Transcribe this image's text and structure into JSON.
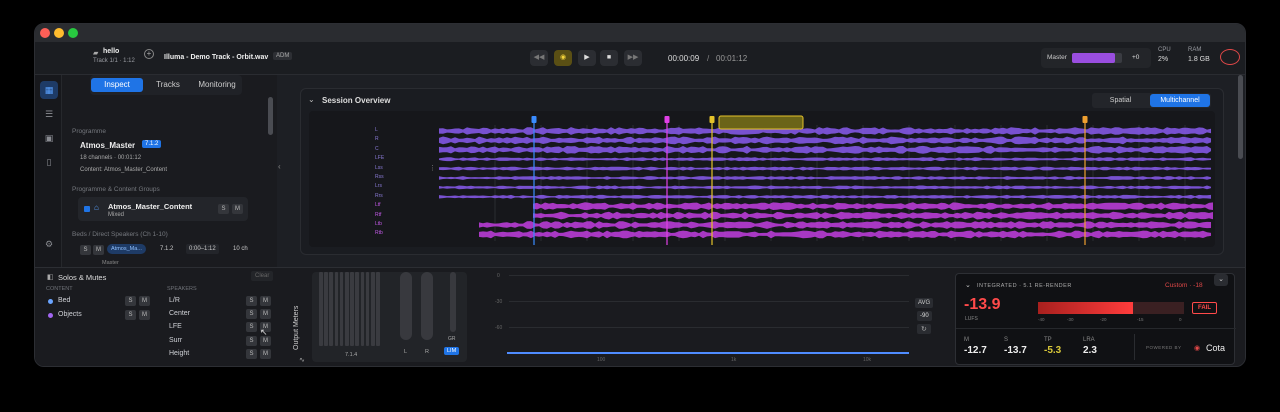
{
  "toolbar": {
    "project_name": "hello",
    "track_info": "Track 1/1 · 1:12",
    "file_title": "Illuma - Demo Track - Orbit.wav",
    "format_badge": "ADM",
    "time_current": "00:00:09",
    "time_sep": "/",
    "time_total": "00:01:12",
    "master_label": "Master",
    "master_gain": "+0",
    "master_level": 0.85,
    "cpu_label": "CPU",
    "cpu_value": "2%",
    "ram_label": "RAM",
    "ram_value": "1.8 GB"
  },
  "inspector": {
    "tabs": [
      "Inspect",
      "Tracks",
      "Monitoring"
    ],
    "active_tab": "Inspect",
    "programme_heading": "Programme",
    "programme_name": "Atmos_Master",
    "programme_badge": "7.1.2",
    "programme_channels": "18 channels · 00:01:12",
    "programme_content": "Content: Atmos_Master_Content",
    "groups_heading": "Programme & Content Groups",
    "group_name": "Atmos_Master_Content",
    "group_kind": "Mixed",
    "beds_heading": "Beds / Direct Speakers (Ch 1-10)",
    "bed_name": "Atmos_Ma...",
    "bed_format": "7.1.2",
    "bed_range": "0:00–1:12",
    "bed_channels": "10 ch",
    "bed_caption": "Master",
    "solo": "S",
    "mute": "M"
  },
  "overview": {
    "title": "Session Overview",
    "view_spatial": "Spatial",
    "view_multichannel": "Multichannel",
    "channels": [
      "L",
      "R",
      "C",
      "LFE",
      "Lss",
      "Rss",
      "Lrs",
      "Rrs",
      "Ltf",
      "Rtf",
      "Ltb",
      "Rtb"
    ]
  },
  "solos": {
    "title": "Solos & Mutes",
    "clear": "Clear",
    "content_heading": "CONTENT",
    "content_items": [
      "Bed",
      "Objects"
    ],
    "speakers_heading": "SPEAKERS",
    "speaker_items": [
      "L/R",
      "Center",
      "LFE",
      "Surr",
      "Height"
    ],
    "solo": "S",
    "mute": "M"
  },
  "meters": {
    "title": "Output Meters",
    "layout": "7.1.4",
    "l_label": "L",
    "r_label": "R",
    "gr_label": "GR",
    "lim_label": "LIM",
    "avg_label": "AVG",
    "avg_value": "-90",
    "scale": [
      "0",
      "-30",
      "-60"
    ],
    "axis_ticks": [
      "100",
      "1k",
      "10k"
    ]
  },
  "loudness": {
    "title": "INTEGRATED · 5.1 RE-RENDER",
    "target": "Custom · -18",
    "integrated_value": "-13.9",
    "integrated_unit": "LUFS",
    "status": "FAIL",
    "scale": [
      "-40",
      "-30",
      "-20",
      "-15",
      "0"
    ],
    "m_label": "M",
    "m_value": "-12.7",
    "s_label": "S",
    "s_value": "-13.7",
    "tp_label": "TP",
    "tp_value": "-5.3",
    "lra_label": "LRA",
    "lra_value": "2.3",
    "powered_by": "POWERED BY",
    "brand": "Cota"
  },
  "colors": {
    "accent": "#1f74e6",
    "purple": "#8a5cf0",
    "magenta": "#c23ee0",
    "yellow": "#e4c22a",
    "fail": "#e04848"
  }
}
